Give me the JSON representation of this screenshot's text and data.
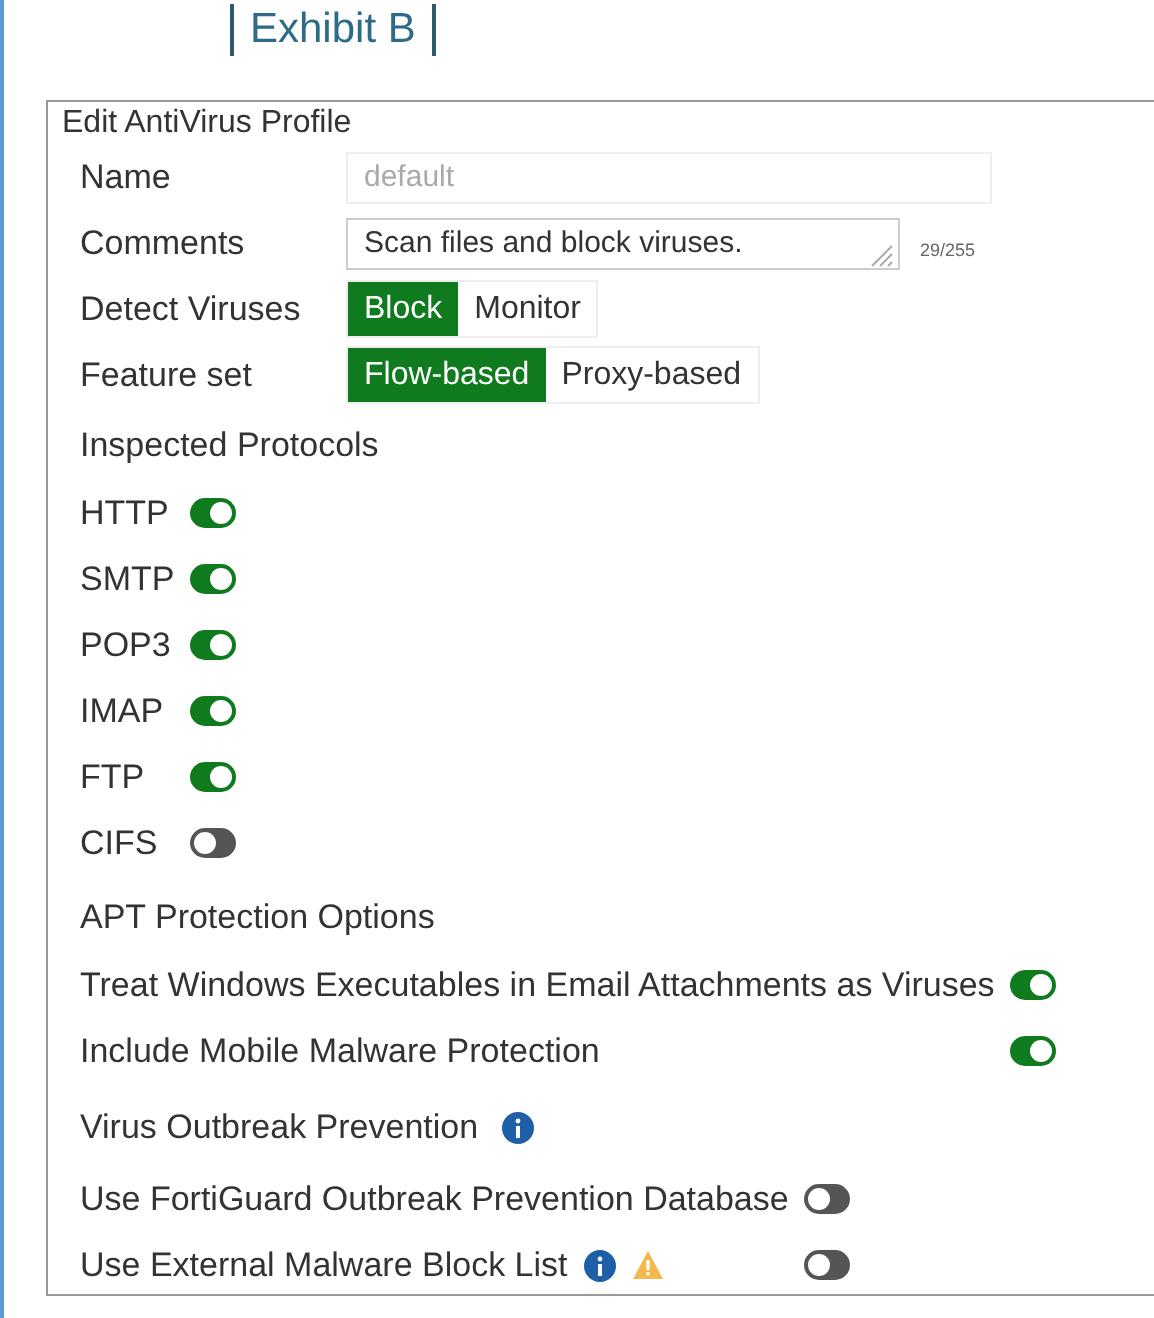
{
  "exhibit_label": "Exhibit B",
  "panel": {
    "title": "Edit AntiVirus Profile",
    "name": {
      "label": "Name",
      "value": "default",
      "disabled": true
    },
    "comments": {
      "label": "Comments",
      "value": "Scan files and block viruses.",
      "counter": "29/255"
    },
    "choices": [
      {
        "label": "Detect Viruses",
        "options": [
          {
            "label": "Block",
            "selected": true
          },
          {
            "label": "Monitor",
            "selected": false
          }
        ]
      },
      {
        "label": "Feature set",
        "options": [
          {
            "label": "Flow-based",
            "selected": true
          },
          {
            "label": "Proxy-based",
            "selected": false
          }
        ]
      }
    ],
    "sections": [
      {
        "heading": "Inspected Protocols",
        "items": [
          {
            "label": "HTTP",
            "on": true
          },
          {
            "label": "SMTP",
            "on": true
          },
          {
            "label": "POP3",
            "on": true
          },
          {
            "label": "IMAP",
            "on": true
          },
          {
            "label": "FTP",
            "on": true
          },
          {
            "label": "CIFS",
            "on": false
          }
        ]
      },
      {
        "heading": "APT Protection Options",
        "items": [
          {
            "label": "Treat Windows Executables in Email Attachments as Viruses",
            "on": true
          },
          {
            "label": "Include Mobile Malware Protection",
            "on": true
          }
        ]
      },
      {
        "heading": "Virus Outbreak Prevention",
        "heading_icons": [
          {
            "kind": "info"
          }
        ],
        "items": [
          {
            "label": "Use FortiGuard Outbreak Prevention Database",
            "on": false
          },
          {
            "label": "Use External Malware Block List",
            "on": false,
            "icons": [
              {
                "kind": "info"
              },
              {
                "kind": "warning"
              }
            ]
          }
        ]
      }
    ]
  }
}
